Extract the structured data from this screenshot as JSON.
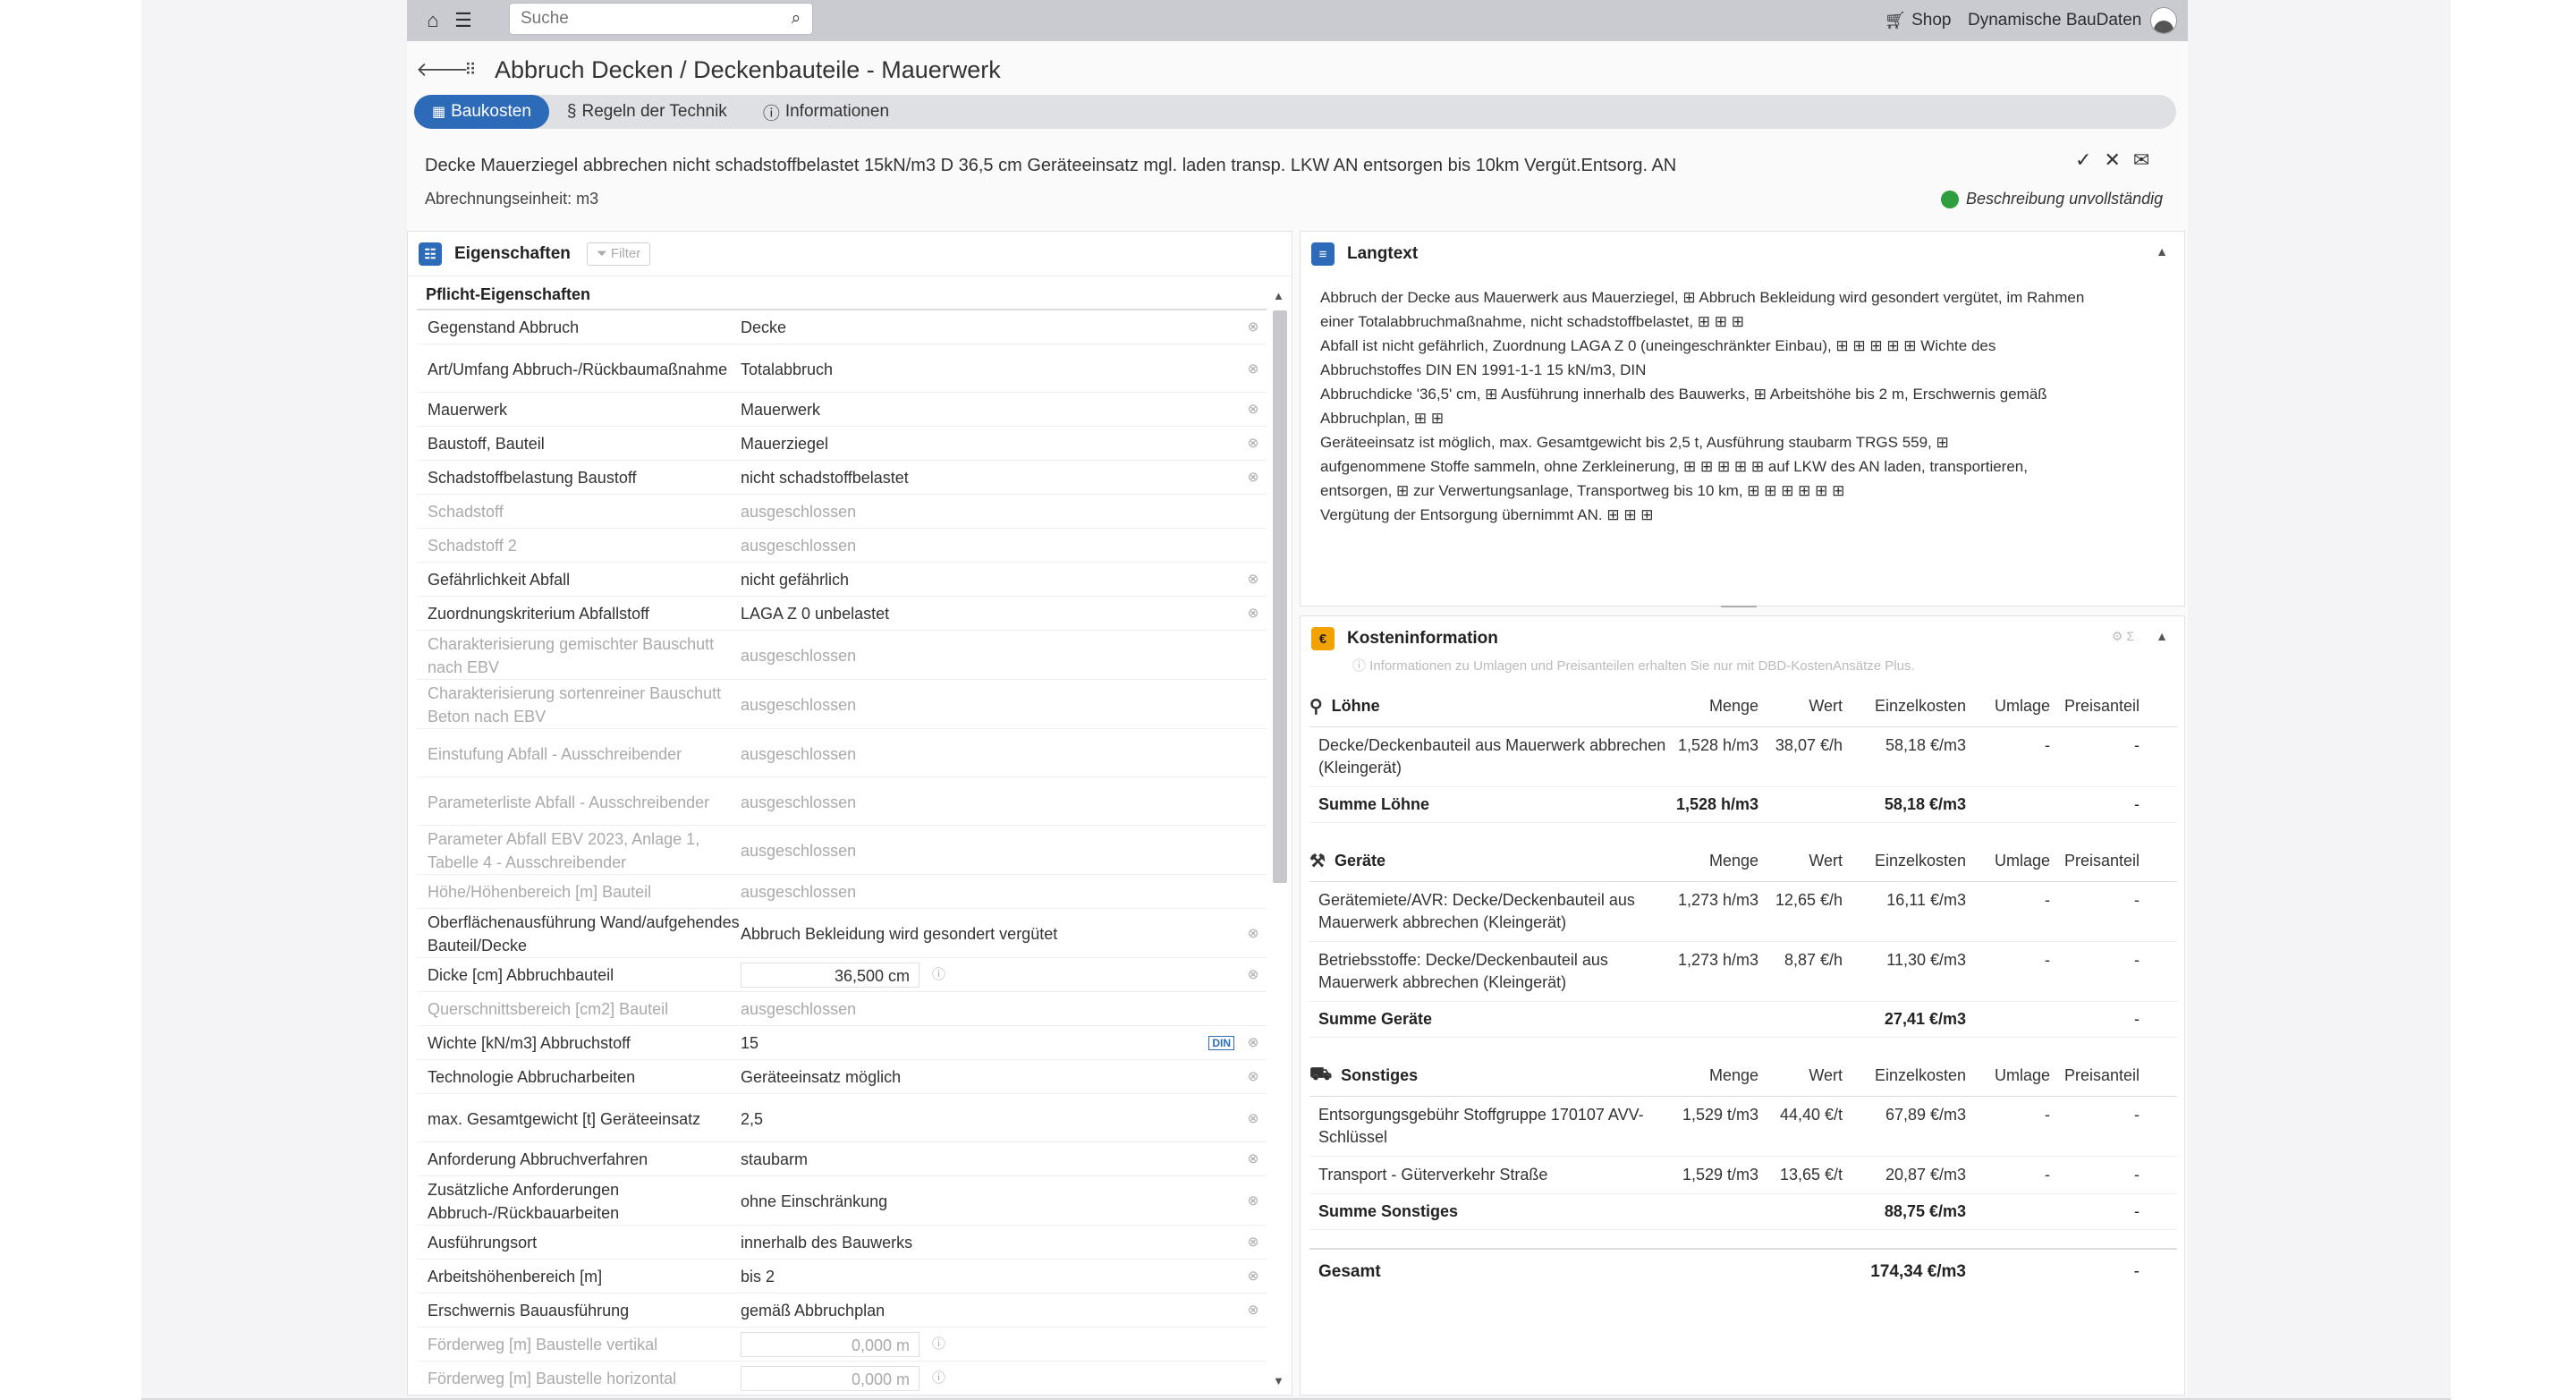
{
  "topbar": {
    "search_placeholder": "Suche",
    "shop": "Shop",
    "user": "Dynamische BauDaten"
  },
  "title": "Abbruch Decken / Deckenbauteile - Mauerwerk",
  "tabs": [
    "Baukosten",
    "Regeln der Technik",
    "Informationen"
  ],
  "description": "Decke Mauerziegel abbrechen nicht schadstoffbelastet 15kN/m3 D 36,5 cm Geräteeinsatz mgl. laden transp. LKW AN entsorgen bis 10km Vergüt.Entsorg. AN",
  "unit": "Abrechnungseinheit: m3",
  "status": "Beschreibung unvollständig",
  "props": {
    "title": "Eigenschaften",
    "filter": "Filter",
    "subtitle": "Pflicht-Eigenschaften",
    "rows": [
      {
        "label": "Gegenstand Abbruch",
        "value": "Decke"
      },
      {
        "label": "Art/Umfang Abbruch-/Rückbaumaßnahme",
        "value": "Totalabbruch"
      },
      {
        "label": "Mauerwerk",
        "value": "Mauerwerk"
      },
      {
        "label": "Baustoff, Bauteil",
        "value": "Mauerziegel"
      },
      {
        "label": "Schadstoffbelastung Baustoff",
        "value": "nicht schadstoffbelastet"
      },
      {
        "label": "Schadstoff",
        "value": "ausgeschlossen",
        "dis": true
      },
      {
        "label": "Schadstoff 2",
        "value": "ausgeschlossen",
        "dis": true
      },
      {
        "label": "Gefährlichkeit Abfall",
        "value": "nicht gefährlich"
      },
      {
        "label": "Zuordnungskriterium Abfallstoff",
        "value": "LAGA Z 0 unbelastet"
      },
      {
        "label": "Charakterisierung gemischter Bauschutt nach EBV",
        "value": "ausgeschlossen",
        "dis": true
      },
      {
        "label": "Charakterisierung sortenreiner Bauschutt Beton nach EBV",
        "value": "ausgeschlossen",
        "dis": true
      },
      {
        "label": "Einstufung Abfall - Ausschreibender",
        "value": "ausgeschlossen",
        "dis": true
      },
      {
        "label": "Parameterliste Abfall - Ausschreibender",
        "value": "ausgeschlossen",
        "dis": true
      },
      {
        "label": "Parameter Abfall EBV 2023, Anlage 1, Tabelle 4 - Ausschreibender",
        "value": "ausgeschlossen",
        "dis": true
      },
      {
        "label": "Höhe/Höhenbereich [m] Bauteil",
        "value": "ausgeschlossen",
        "dis": true
      },
      {
        "label": "Oberflächenausführung Wand/aufgehendes Bauteil/Decke",
        "value": "Abbruch Bekleidung wird gesondert vergütet"
      },
      {
        "label": "Dicke [cm] Abbruchbauteil",
        "value": "36,500 cm",
        "num": true
      },
      {
        "label": "Querschnittsbereich [cm2] Bauteil",
        "value": "ausgeschlossen",
        "dis": true
      },
      {
        "label": "Wichte [kN/m3] Abbruchstoff",
        "value": "15",
        "din": true
      },
      {
        "label": "Technologie Abbrucharbeiten",
        "value": "Geräteeinsatz möglich"
      },
      {
        "label": "max. Gesamtgewicht [t] Geräteeinsatz",
        "value": "2,5"
      },
      {
        "label": "Anforderung Abbruchverfahren",
        "value": "staubarm"
      },
      {
        "label": "Zusätzliche Anforderungen Abbruch-/Rückbauarbeiten",
        "value": "ohne Einschränkung"
      },
      {
        "label": "Ausführungsort",
        "value": "innerhalb des Bauwerks"
      },
      {
        "label": "Arbeitshöhenbereich [m]",
        "value": "bis 2"
      },
      {
        "label": "Erschwernis Bauausführung",
        "value": "gemäß Abbruchplan"
      },
      {
        "label": "Förderweg [m] Baustelle vertikal",
        "value": "0,000 m",
        "num": true,
        "dis": true
      },
      {
        "label": "Förderweg [m] Baustelle horizontal",
        "value": "0,000 m",
        "num": true,
        "dis": true
      }
    ]
  },
  "langtext": {
    "title": "Langtext",
    "lines": [
      "Abbruch der Decke aus Mauerwerk aus Mauerziegel, ⊞ Abbruch Bekleidung wird gesondert vergütet, im Rahmen",
      "einer Totalabbruchmaßnahme, nicht schadstoffbelastet, ⊞ ⊞ ⊞",
      "Abfall ist nicht gefährlich, Zuordnung LAGA Z 0 (uneingeschränkter Einbau), ⊞ ⊞ ⊞ ⊞ ⊞ Wichte des",
      "Abbruchstoffes DIN EN 1991-1-1 15 kN/m3, DIN",
      "Abbruchdicke '36,5' cm, ⊞ Ausführung innerhalb des Bauwerks, ⊞ Arbeitshöhe bis 2 m, Erschwernis gemäß",
      "Abbruchplan, ⊞ ⊞",
      "Geräteeinsatz ist möglich, max. Gesamtgewicht bis 2,5 t, Ausführung staubarm TRGS 559, ⊞",
      "aufgenommene Stoffe sammeln, ohne Zerkleinerung, ⊞ ⊞ ⊞ ⊞ ⊞ auf LKW des AN laden, transportieren,",
      "entsorgen, ⊞ zur Verwertungsanlage, Transportweg bis 10 km, ⊞ ⊞ ⊞ ⊞ ⊞ ⊞",
      "Vergütung der Entsorgung übernimmt AN. ⊞ ⊞ ⊞"
    ]
  },
  "cost": {
    "title": "Kosteninformation",
    "hint": "ⓘ Informationen zu Umlagen und Preisanteilen erhalten Sie nur mit DBD-KostenAnsätze Plus.",
    "cols": [
      "Menge",
      "Wert",
      "Einzelkosten",
      "Umlage",
      "Preisanteil"
    ],
    "groups": [
      {
        "name": "Löhne",
        "icon": "person-icon",
        "rows": [
          {
            "name": "Decke/Deckenbauteil aus Mauerwerk abbrechen (Kleingerät)",
            "menge": "1,528 h/m3",
            "wert": "38,07 €/h",
            "ek": "58,18 €/m3",
            "um": "-",
            "pa": "-"
          }
        ],
        "sum": {
          "name": "Summe Löhne",
          "menge": "1,528 h/m3",
          "ek": "58,18 €/m3",
          "pa": "-"
        }
      },
      {
        "name": "Geräte",
        "icon": "crane-icon",
        "rows": [
          {
            "name": "Gerätemiete/AVR: Decke/Deckenbauteil aus Mauerwerk abbrechen (Kleingerät)",
            "menge": "1,273 h/m3",
            "wert": "12,65 €/h",
            "ek": "16,11 €/m3",
            "um": "-",
            "pa": "-"
          },
          {
            "name": "Betriebsstoffe: Decke/Deckenbauteil aus Mauerwerk abbrechen (Kleingerät)",
            "menge": "1,273 h/m3",
            "wert": "8,87 €/h",
            "ek": "11,30 €/m3",
            "um": "-",
            "pa": "-"
          }
        ],
        "sum": {
          "name": "Summe Geräte",
          "menge": "",
          "ek": "27,41 €/m3",
          "pa": "-"
        }
      },
      {
        "name": "Sonstiges",
        "icon": "truck-icon",
        "rows": [
          {
            "name": "Entsorgungsgebühr Stoffgruppe 170107 AVV-Schlüssel",
            "menge": "1,529 t/m3",
            "wert": "44,40 €/t",
            "ek": "67,89 €/m3",
            "um": "-",
            "pa": "-"
          },
          {
            "name": "Transport - Güterverkehr Straße",
            "menge": "1,529 t/m3",
            "wert": "13,65 €/t",
            "ek": "20,87 €/m3",
            "um": "-",
            "pa": "-"
          }
        ],
        "sum": {
          "name": "Summe Sonstiges",
          "menge": "",
          "ek": "88,75 €/m3",
          "pa": "-"
        }
      }
    ],
    "total": {
      "name": "Gesamt",
      "ek": "174,34 €/m3",
      "pa": "-"
    }
  }
}
